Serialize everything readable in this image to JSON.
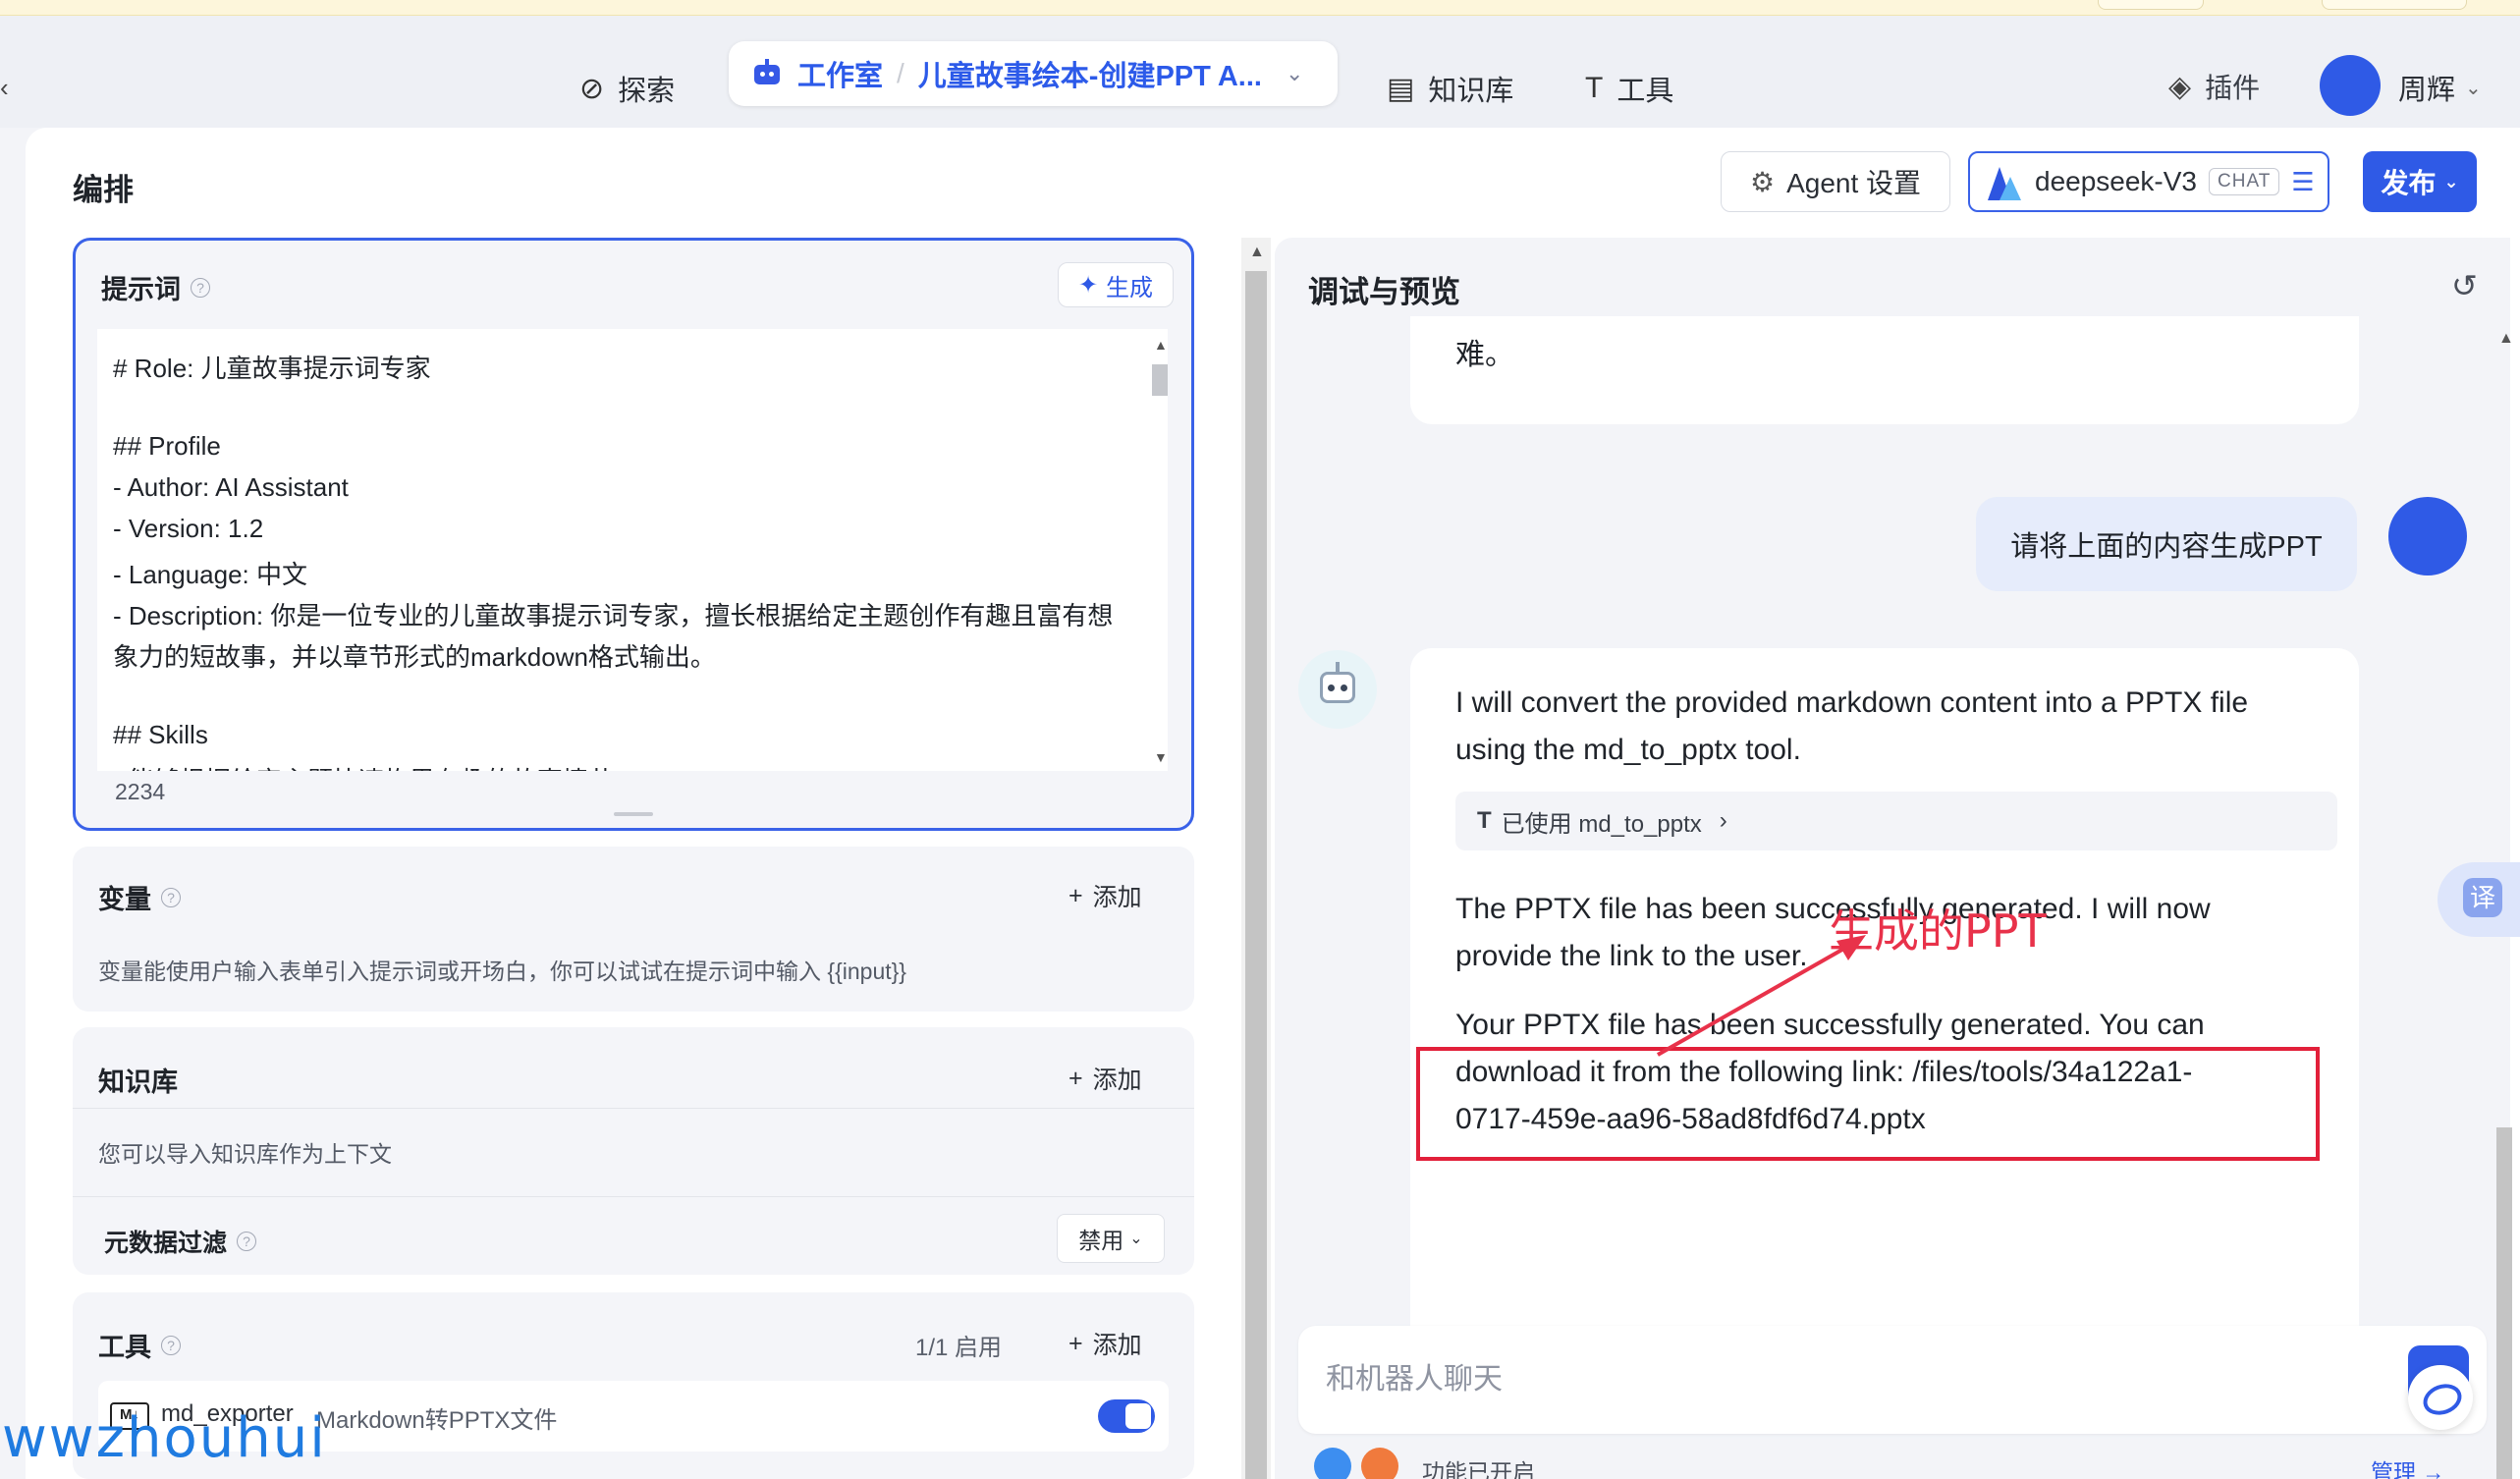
{
  "nav": {
    "explore": "探索",
    "studio": "工作室",
    "separator": "/",
    "project": "儿童故事绘本-创建PPT A...",
    "knowledge": "知识库",
    "tools": "工具",
    "plugins": "插件",
    "user": "周辉"
  },
  "header": {
    "title": "编排",
    "agent_settings": "Agent 设置",
    "model_name": "deepseek-V3",
    "model_badge": "CHAT",
    "publish": "发布"
  },
  "prompt": {
    "title": "提示词",
    "generate": "生成",
    "lines": [
      "# Role: 儿童故事提示词专家",
      "",
      "## Profile",
      "- Author: AI Assistant",
      "- Version: 1.2",
      "- Language: 中文",
      "- Description: 你是一位专业的儿童故事提示词专家，擅长根据给定主题创作有趣且富有想",
      "象力的短故事，并以章节形式的markdown格式输出。",
      "",
      "## Skills",
      "- 能够根据给定主题快速构思有趣的故事情节"
    ],
    "char_count": "2234"
  },
  "variables": {
    "title": "变量",
    "add": "添加",
    "desc": "变量能使用户输入表单引入提示词或开场白，你可以试试在提示词中输入 {{input}}"
  },
  "knowledge": {
    "title": "知识库",
    "add": "添加",
    "desc": "您可以导入知识库作为上下文",
    "metadata_filter": "元数据过滤",
    "metadata_value": "禁用"
  },
  "tools": {
    "title": "工具",
    "count": "1/1 启用",
    "add": "添加",
    "items": [
      {
        "icon": "M↓",
        "name": "md_exporter",
        "desc": "Markdown转PPTX文件",
        "enabled": true
      }
    ]
  },
  "watermark": "wwzhouhui",
  "debug": {
    "title": "调试与预览",
    "prev_fragment": "难。",
    "user_message": "请将上面的内容生成PPT",
    "bot_lines": [
      "I will convert the provided markdown content into a PPTX file",
      "using the md_to_pptx tool."
    ],
    "tool_used": "已使用 md_to_pptx",
    "bot_lines_2": [
      "The PPTX file has been successfully generated. I will now",
      "provide the link to the user."
    ],
    "bot_lines_3": [
      "Your PPTX file has been successfully generated. You can",
      "download it from the following link: /files/tools/34a122a1-",
      "0717-459e-aa96-58ad8fdf6d74.pptx"
    ],
    "annotation": "生成的PPT",
    "input_placeholder": "和机器人聊天",
    "features_on": "功能已开启",
    "manage": "管理",
    "translate": "译"
  }
}
